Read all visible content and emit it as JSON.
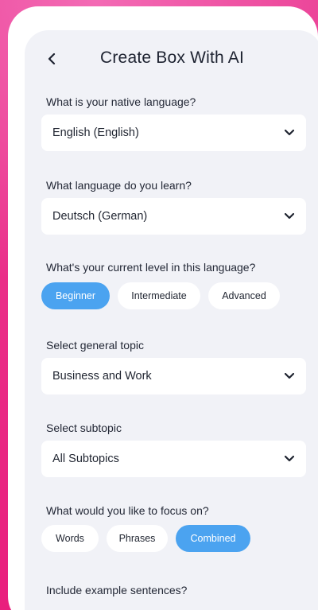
{
  "header": {
    "title": "Create Box With AI"
  },
  "native_language": {
    "label": "What is your native language?",
    "value": "English (English)"
  },
  "learn_language": {
    "label": "What language do you learn?",
    "value": "Deutsch (German)"
  },
  "level": {
    "label": "What's your current level in this language?",
    "options": [
      "Beginner",
      "Intermediate",
      "Advanced"
    ],
    "selected": "Beginner"
  },
  "topic": {
    "label": "Select general topic",
    "value": "Business and Work"
  },
  "subtopic": {
    "label": "Select subtopic",
    "value": "All Subtopics"
  },
  "focus": {
    "label": "What would you like to focus on?",
    "options": [
      "Words",
      "Phrases",
      "Combined"
    ],
    "selected": "Combined"
  },
  "examples": {
    "label": "Include example sentences?"
  },
  "colors": {
    "accent": "#4ba3f0",
    "background": "#e8237f",
    "screen": "#f1f2f7"
  }
}
